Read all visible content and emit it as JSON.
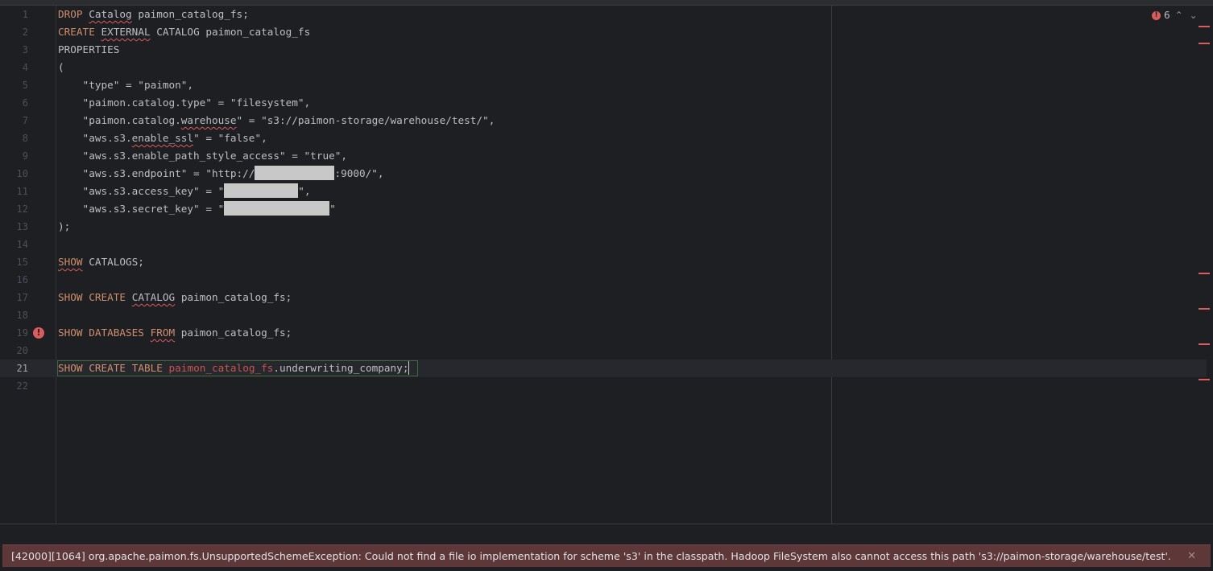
{
  "editor": {
    "inspection": {
      "error_count": "6"
    },
    "lines": [
      {
        "n": "1"
      },
      {
        "n": "2"
      },
      {
        "n": "3"
      },
      {
        "n": "4"
      },
      {
        "n": "5"
      },
      {
        "n": "6"
      },
      {
        "n": "7"
      },
      {
        "n": "8"
      },
      {
        "n": "9"
      },
      {
        "n": "10"
      },
      {
        "n": "11"
      },
      {
        "n": "12"
      },
      {
        "n": "13"
      },
      {
        "n": "14"
      },
      {
        "n": "15"
      },
      {
        "n": "16"
      },
      {
        "n": "17"
      },
      {
        "n": "18"
      },
      {
        "n": "19"
      },
      {
        "n": "20"
      },
      {
        "n": "21"
      },
      {
        "n": "22"
      }
    ],
    "code": {
      "l1": {
        "kw": "DROP",
        "kw2": "Catalog",
        "name": "paimon_catalog_fs",
        "end": ";"
      },
      "l2": {
        "kw": "CREATE",
        "kw2": "EXTERNAL",
        "kw3": "CATALOG",
        "name": "paimon_catalog_fs"
      },
      "l3": {
        "text": "PROPERTIES"
      },
      "l4": {
        "text": "("
      },
      "l5": {
        "text": "    \"type\" = \"paimon\","
      },
      "l6": {
        "text": "    \"paimon.catalog.type\" = \"filesystem\","
      },
      "l7": {
        "a": "    \"paimon.catalog.",
        "b": "warehouse",
        "c": "\" = \"s3://paimon-storage/warehouse/test/\","
      },
      "l8": {
        "a": "    \"aws.s3.",
        "b": "enable_ssl",
        "c": "\" = \"false\","
      },
      "l9": {
        "text": "    \"aws.s3.enable_path_style_access\" = \"true\","
      },
      "l10": {
        "a": "    \"aws.s3.endpoint\" = \"http://",
        "c": ":9000/\","
      },
      "l11": {
        "a": "    \"aws.s3.access_key\" = \"",
        "c": "\","
      },
      "l12": {
        "a": "    \"aws.s3.secret_key\" = \"",
        "c": "\""
      },
      "l13": {
        "text": ");"
      },
      "l15": {
        "kw": "SHOW",
        "name": " CATALOGS;"
      },
      "l17": {
        "kw": "SHOW",
        "kw2": "CREATE",
        "kw3": "CATALOG",
        "name": "paimon_catalog_fs;"
      },
      "l19": {
        "kw": "SHOW",
        "kw2": "DATABASES",
        "kw3": "FROM",
        "name": "paimon_catalog_fs;"
      },
      "l21": {
        "kw": "SHOW",
        "kw2": "CREATE",
        "kw3": "TABLE",
        "schema": "paimon_catalog_fs",
        "table": ".underwriting_company",
        "end": ";"
      }
    }
  },
  "error": {
    "message": "[42000][1064] org.apache.paimon.fs.UnsupportedSchemeException: Could not find a file io implementation for scheme 's3' in the classpath. Hadoop FileSystem also cannot access this path 's3://paimon-storage/warehouse/test'.",
    "close": "✕"
  },
  "colors": {
    "keyword": "#cf8e6d",
    "error": "#db5c5c",
    "background": "#1e1f22",
    "error_bar": "#5e3838"
  }
}
